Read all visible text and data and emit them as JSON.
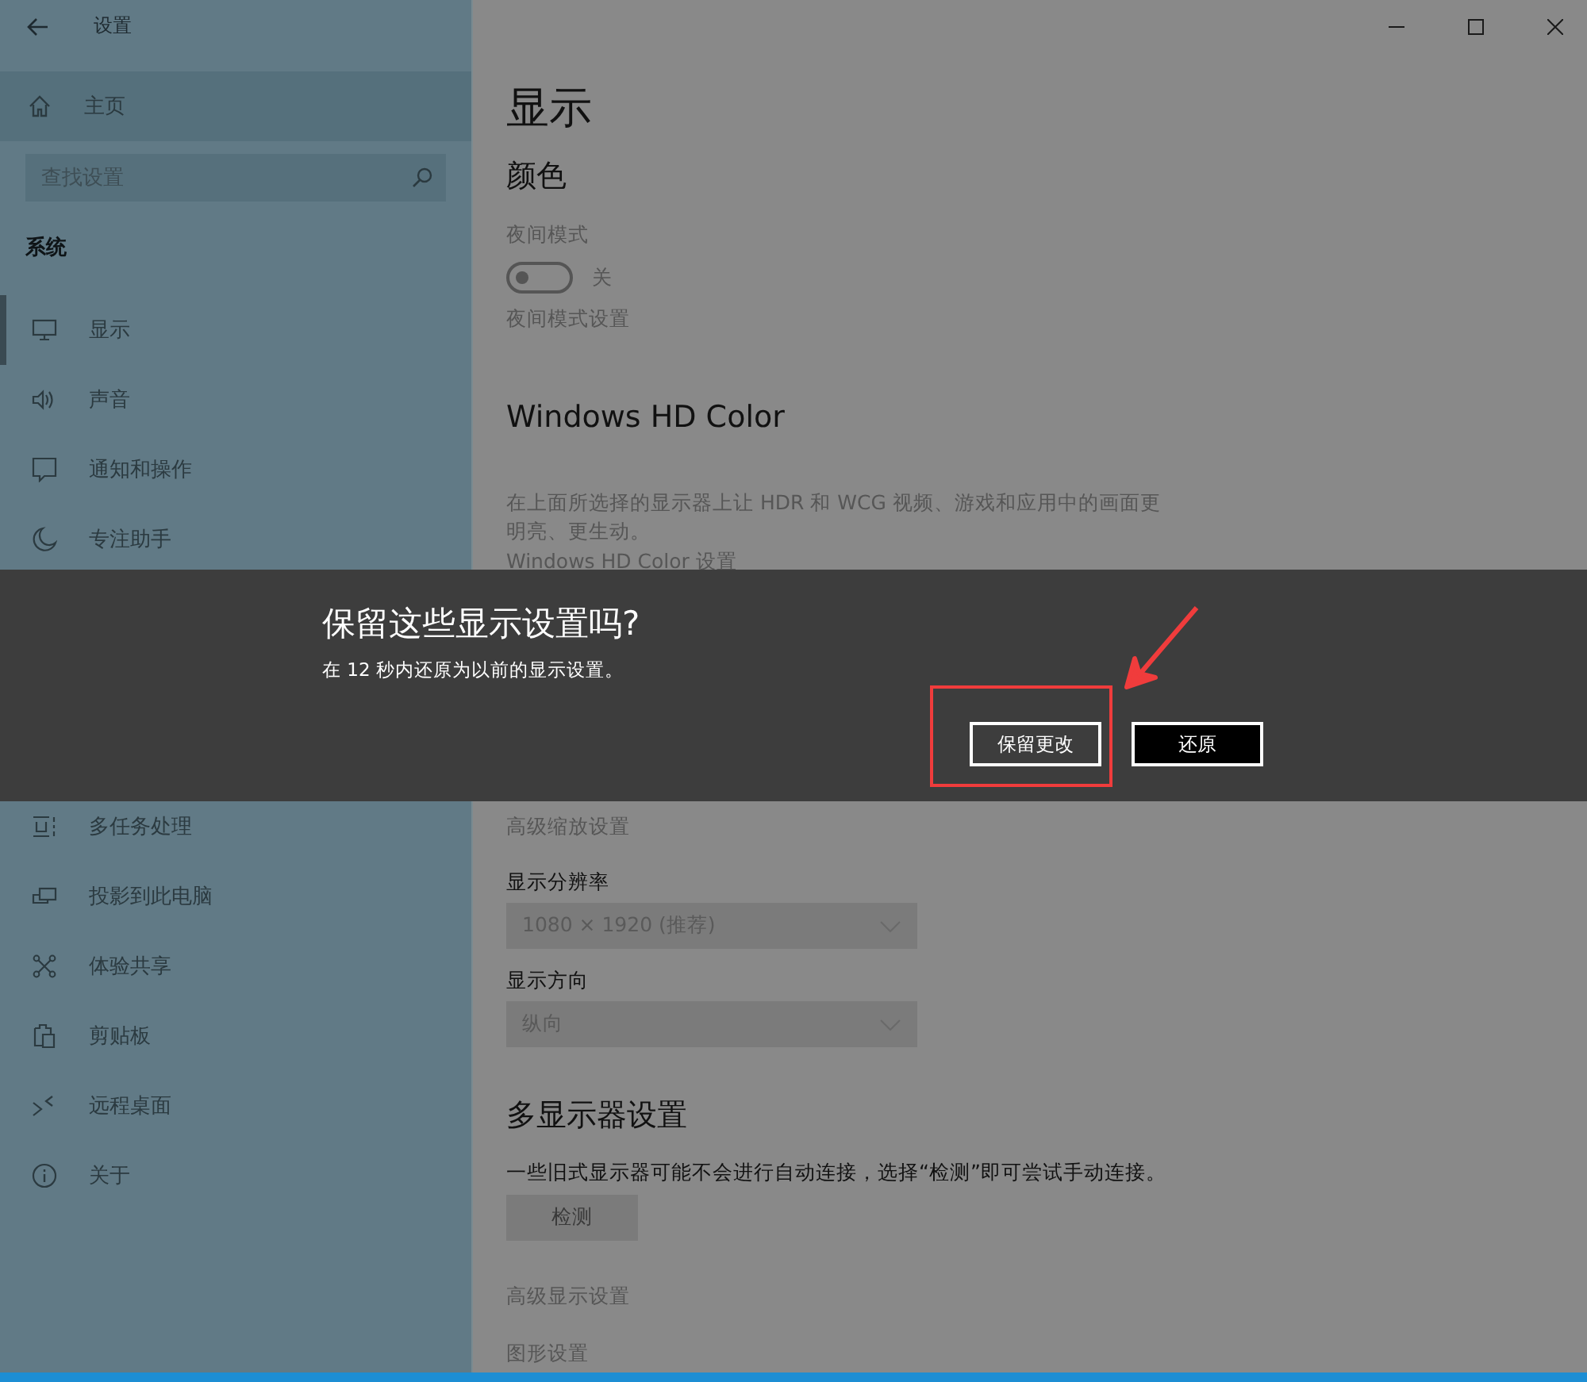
{
  "window": {
    "title": "设置"
  },
  "sidebar": {
    "home": "主页",
    "search": {
      "placeholder": "查找设置"
    },
    "section": "系统",
    "items_top": [
      {
        "label": "显示",
        "selected": true
      },
      {
        "label": "声音",
        "selected": false
      },
      {
        "label": "通知和操作",
        "selected": false
      },
      {
        "label": "专注助手",
        "selected": false
      }
    ],
    "items_bottom": [
      {
        "label": "多任务处理",
        "selected": false
      },
      {
        "label": "投影到此电脑",
        "selected": false
      },
      {
        "label": "体验共享",
        "selected": false
      },
      {
        "label": "剪贴板",
        "selected": false
      },
      {
        "label": "远程桌面",
        "selected": false
      },
      {
        "label": "关于",
        "selected": false
      }
    ]
  },
  "content": {
    "title": "显示",
    "color_heading": "颜色",
    "night_label": "夜间模式",
    "night_toggle": {
      "on": false,
      "state_label": "关"
    },
    "night_link": "夜间模式设置",
    "hd_heading": "Windows HD Color",
    "hd_text": "在上面所选择的显示器上让 HDR 和 WCG 视频、游戏和应用中的画面更明亮、更生动。",
    "hd_link": "Windows HD Color 设置",
    "scale_link": "高级缩放设置",
    "resolution_label": "显示分辨率",
    "resolution_value": "1080 × 1920 (推荐)",
    "orientation_label": "显示方向",
    "orientation_value": "纵向",
    "multi_heading": "多显示器设置",
    "multi_text": "一些旧式显示器可能不会进行自动连接，选择“检测”即可尝试手动连接。",
    "detect_button": "检测",
    "advanced_link": "高级显示设置",
    "graphics_link": "图形设置"
  },
  "dialog": {
    "title": "保留这些显示设置吗?",
    "message": "在 12 秒内还原为以前的显示设置。",
    "buttons": [
      {
        "label": "保留更改",
        "kind": "keep"
      },
      {
        "label": "还原",
        "kind": "revert"
      }
    ]
  }
}
